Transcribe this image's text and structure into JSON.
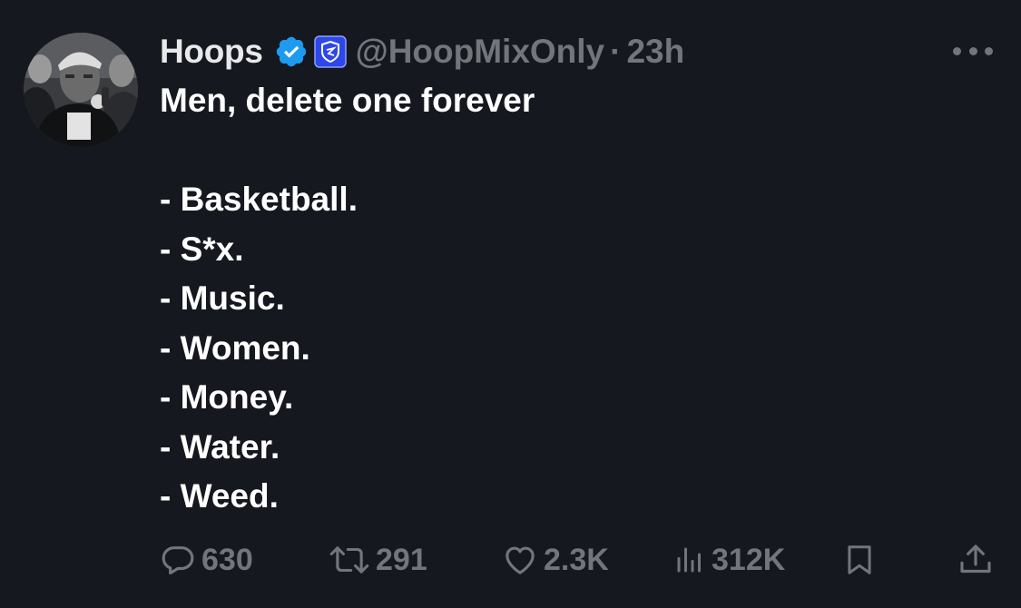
{
  "tweet": {
    "author": {
      "name": "Hoops",
      "handle": "@HoopMixOnly",
      "separator": "·",
      "time": "23h"
    },
    "lines": [
      "Men, delete one forever",
      "",
      "- Basketball.",
      "- S*x.",
      "- Music.",
      "- Women.",
      "- Money.",
      "- Water.",
      "- Weed."
    ],
    "stats": {
      "replies": "630",
      "reposts": "291",
      "likes": "2.3K",
      "views": "312K"
    }
  },
  "colors": {
    "background": "#16181f",
    "text": "#ffffff",
    "muted": "#71767b",
    "verified": "#1d9bf0",
    "affiliate_badge": "#2f46e8"
  },
  "icons": {
    "verified": "verified-badge-icon",
    "affiliate": "shield-badge-icon",
    "more": "more-dots-icon",
    "reply": "speech-bubble-icon",
    "repost": "repost-arrows-icon",
    "like": "heart-icon",
    "views": "bar-chart-icon",
    "bookmark": "bookmark-icon",
    "share": "share-upload-icon"
  }
}
